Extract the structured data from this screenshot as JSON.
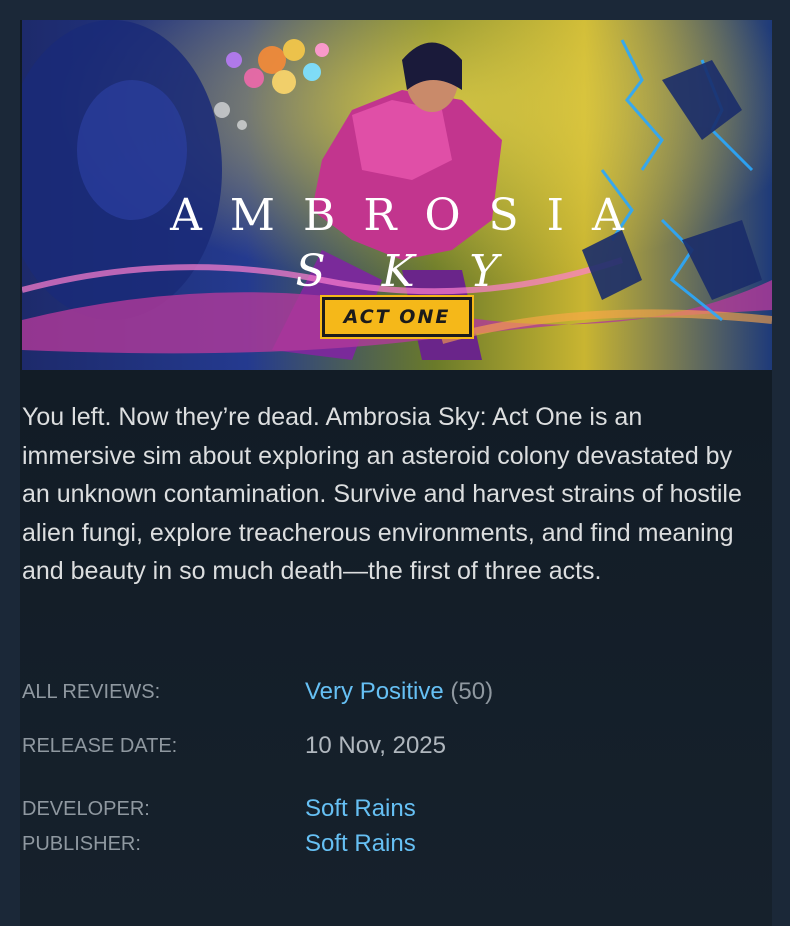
{
  "capsule": {
    "logo_title": "AMBROSIA",
    "logo_subtitle": "SKY",
    "act_badge": "ACT ONE"
  },
  "description": "You left. Now they’re dead. Ambrosia Sky: Act One is an immersive sim about exploring an asteroid colony devastated by an unknown contamination. Survive and harvest strains of hostile alien fungi, explore treacherous environments, and find meaning and beauty in so much death—the first of three acts.",
  "reviews": {
    "label": "ALL REVIEWS:",
    "summary": "Very Positive",
    "count": "(50)"
  },
  "release": {
    "label": "RELEASE DATE:",
    "date": "10 Nov, 2025"
  },
  "developer": {
    "label": "DEVELOPER:",
    "name": "Soft Rains"
  },
  "publisher": {
    "label": "PUBLISHER:",
    "name": "Soft Rains"
  },
  "colors": {
    "background": "#1b2838",
    "link": "#66c0f4",
    "label": "#8f98a0",
    "text": "#dcdedf",
    "badge": "#f5b819"
  }
}
